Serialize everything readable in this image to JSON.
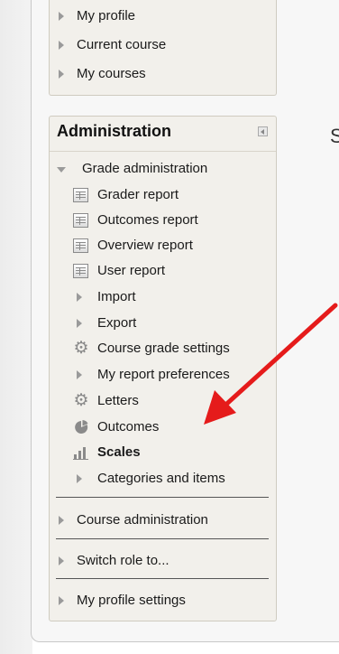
{
  "navigation": {
    "items": [
      {
        "label": "My profile"
      },
      {
        "label": "Current course"
      },
      {
        "label": "My courses"
      }
    ]
  },
  "administration": {
    "title": "Administration",
    "grade_admin": {
      "label": "Grade administration",
      "items": [
        {
          "label": "Grader report",
          "icon": "report-icon"
        },
        {
          "label": "Outcomes report",
          "icon": "report-icon"
        },
        {
          "label": "Overview report",
          "icon": "report-icon"
        },
        {
          "label": "User report",
          "icon": "report-icon"
        },
        {
          "label": "Import",
          "icon": "expand-arrow"
        },
        {
          "label": "Export",
          "icon": "expand-arrow"
        },
        {
          "label": "Course grade settings",
          "icon": "gear-icon"
        },
        {
          "label": "My report preferences",
          "icon": "expand-arrow"
        },
        {
          "label": "Letters",
          "icon": "gear-icon"
        },
        {
          "label": "Outcomes",
          "icon": "pie-chart-icon"
        },
        {
          "label": "Scales",
          "icon": "bar-chart-icon",
          "active": true
        },
        {
          "label": "Categories and items",
          "icon": "expand-arrow"
        }
      ]
    },
    "sections": [
      {
        "label": "Course administration"
      },
      {
        "label": "Switch role to..."
      },
      {
        "label": "My profile settings"
      }
    ]
  },
  "partial_text": "S",
  "colors": {
    "arrow": "#e51b1b",
    "block_bg": "#f2f0eb",
    "icon_gray": "#8a8a8a"
  }
}
